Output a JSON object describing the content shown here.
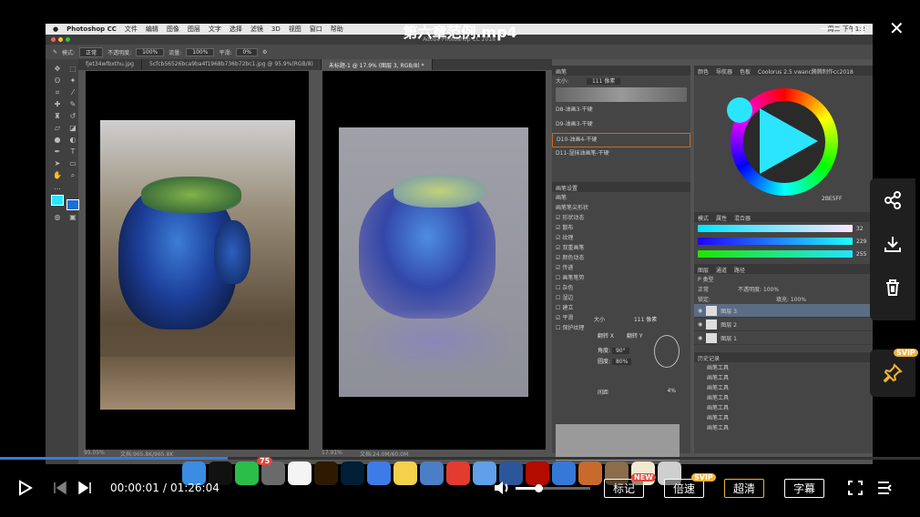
{
  "video": {
    "title": "第六章范例.mp4",
    "current_time": "00:00:01",
    "total_time": "01:26:04",
    "time_separator": "/",
    "progress_fraction": 0.0002,
    "volume_fraction": 0.3
  },
  "player_buttons": {
    "mark": "标记",
    "mark_badge": "NEW",
    "speed": "倍速",
    "speed_badge": "SVIP",
    "quality": "超清",
    "subtitle": "字幕",
    "svip_badge": "SVIP"
  },
  "mac_menu": {
    "app": "Photoshop CC",
    "items": [
      "文件",
      "编辑",
      "图像",
      "图层",
      "文字",
      "选择",
      "滤镜",
      "3D",
      "视图",
      "窗口",
      "帮助"
    ],
    "clock": "周二 下午1:2"
  },
  "ps": {
    "window_title": "Adobe Photoshop CC 2018",
    "options": {
      "mode_label": "模式:",
      "mode_value": "正常",
      "opacity_label": "不透明度:",
      "opacity_value": "100%",
      "flow_label": "流量:",
      "flow_value": "100%",
      "smooth_label": "平滑:",
      "smooth_value": "0%"
    },
    "tabs": [
      "fjet34wfbxthu.jpg",
      "5cfcb56526bca9ba4f1968b736b72bc1.jpg @ 95.9%(RGB/8)",
      "未标题-1 @ 17.9% (图层 3, RGB/8) *"
    ],
    "status_left_zoom": "95.05%",
    "status_left_doc": "文档:965.8K/965.8K",
    "status_right_zoom": "17.91%",
    "status_right_doc": "文档:24.0M/60.0M",
    "brush_panel": {
      "title": "画笔",
      "size_label": "大小:",
      "size_value": "111 像素",
      "presets": [
        "D8-油画3-干硬",
        "D9-油画3-干硬",
        "D10-油画4-干硬",
        "D11-湿抹油画笔-干硬"
      ]
    },
    "brush_settings": {
      "title": "画笔设置",
      "tab": "画笔",
      "shape_label": "画笔笔尖形状",
      "options": [
        {
          "label": "形状动态",
          "checked": true
        },
        {
          "label": "散布",
          "checked": true
        },
        {
          "label": "纹理",
          "checked": true
        },
        {
          "label": "双重画笔",
          "checked": true
        },
        {
          "label": "颜色动态",
          "checked": true
        },
        {
          "label": "传递",
          "checked": true
        },
        {
          "label": "画笔笔势",
          "checked": false
        },
        {
          "label": "杂色",
          "checked": false
        },
        {
          "label": "湿边",
          "checked": false
        },
        {
          "label": "建立",
          "checked": false
        },
        {
          "label": "平滑",
          "checked": true
        },
        {
          "label": "保护纹理",
          "checked": false
        }
      ],
      "size_label": "大小",
      "size_value": "111 像素",
      "flip_x": "翻转 X",
      "flip_y": "翻转 Y",
      "angle_label": "角度:",
      "angle_value": "90°",
      "roundness_label": "圆度:",
      "roundness_value": "80%",
      "spacing_label": "间距",
      "spacing_value": "4%"
    },
    "color_panel": {
      "tabs": [
        "颜色",
        "导航器",
        "色板"
      ],
      "plugin": "Coolorus 2.5 vwanc腾腾制作cc2018",
      "hex": "2BE5FF",
      "accent": "#2be5ff"
    },
    "color_sliders": {
      "tabs": [
        "模式",
        "属性",
        "混合器"
      ],
      "values": [
        "32",
        "229",
        "255"
      ]
    },
    "layers": {
      "tabs": [
        "图层",
        "通道",
        "路径"
      ],
      "kind_label": "P 类型",
      "blend": "正常",
      "opacity_label": "不透明度:",
      "opacity_value": "100%",
      "fill_label": "填充:",
      "fill_value": "100%",
      "lock_label": "锁定:",
      "items": [
        "图层 3",
        "图层 2",
        "图层 1"
      ]
    },
    "history": {
      "title": "历史记录",
      "items": [
        "画笔工具",
        "画笔工具",
        "画笔工具",
        "画笔工具",
        "画笔工具",
        "画笔工具",
        "画笔工具"
      ]
    }
  },
  "dock_icons": [
    "finder-icon",
    "qq-icon",
    "wechat-icon",
    "launchpad-icon",
    "chrome-icon",
    "illustrator-icon",
    "photoshop-icon",
    "baidu-netdisk-icon",
    "notes-icon",
    "preview-icon",
    "weibo-icon",
    "lark-icon",
    "word-icon",
    "acrobat-icon",
    "p-icon",
    "app-icon",
    "photos-icon",
    "app2-icon",
    "trash-icon"
  ],
  "dock_badge": "75"
}
